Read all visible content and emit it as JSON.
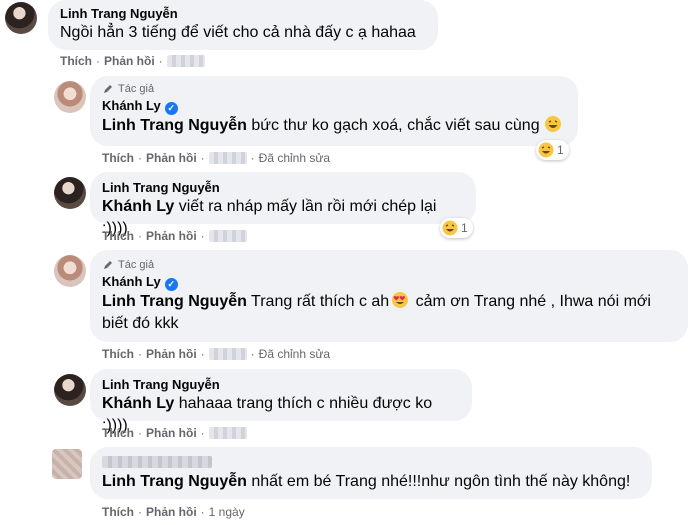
{
  "comments": [
    {
      "author": "Linh Trang Nguyễn",
      "text": "Ngồi hẳn 3 tiếng để viết cho cả nhà đấy c ạ hahaa",
      "actions": {
        "like": "Thích",
        "reply": "Phản hồi"
      }
    },
    {
      "author_badge": "Tác giả",
      "author": "Khánh Ly",
      "mention": "Linh Trang Nguyễn",
      "text": " bức thư ko gạch xoá, chắc viết sau cùng",
      "actions": {
        "like": "Thích",
        "reply": "Phản hồi",
        "edited": "Đã chỉnh sửa"
      },
      "reaction_count": "1"
    },
    {
      "author": "Linh Trang Nguyễn",
      "mention": "Khánh Ly",
      "text": " viết ra nháp mấy lần rồi mới chép lại :))))",
      "actions": {
        "like": "Thích",
        "reply": "Phản hồi"
      },
      "reaction_count": "1"
    },
    {
      "author_badge": "Tác giả",
      "author": "Khánh Ly",
      "mention": "Linh Trang Nguyễn",
      "text_1": " Trang rất thích c ah",
      "text_2": " cảm ơn Trang nhé , Ihwa nói mới",
      "text_3": "biết đó kkk",
      "actions": {
        "like": "Thích",
        "reply": "Phản hồi",
        "edited": "Đã chỉnh sửa"
      }
    },
    {
      "author": "Linh Trang Nguyễn",
      "mention": "Khánh Ly",
      "text": " hahaaa trang thích c nhiều được ko :))))",
      "actions": {
        "like": "Thích",
        "reply": "Phản hồi"
      }
    },
    {
      "mention": "Linh Trang Nguyễn",
      "text": " nhất em bé Trang nhé!!!như ngôn tình thế này không!",
      "actions": {
        "like": "Thích",
        "reply": "Phản hồi",
        "time": "1 ngày"
      }
    }
  ],
  "colors": {
    "bubble": "#f0f2f5",
    "secondary_text": "#65676b",
    "verified": "#1877f2"
  },
  "icons": [
    "pen-icon",
    "verified-icon",
    "laugh-icon",
    "heart-eyes-icon"
  ]
}
